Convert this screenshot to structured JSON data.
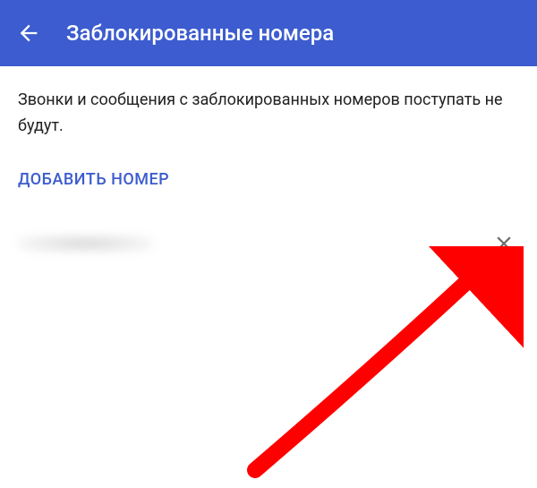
{
  "header": {
    "title": "Заблокированные номера"
  },
  "content": {
    "description": "Звонки и сообщения с заблокированных номеров поступать не будут.",
    "add_button_label": "ДОБАВИТЬ НОМЕР"
  },
  "colors": {
    "primary": "#3c5ccf",
    "arrow": "#ff0000"
  }
}
